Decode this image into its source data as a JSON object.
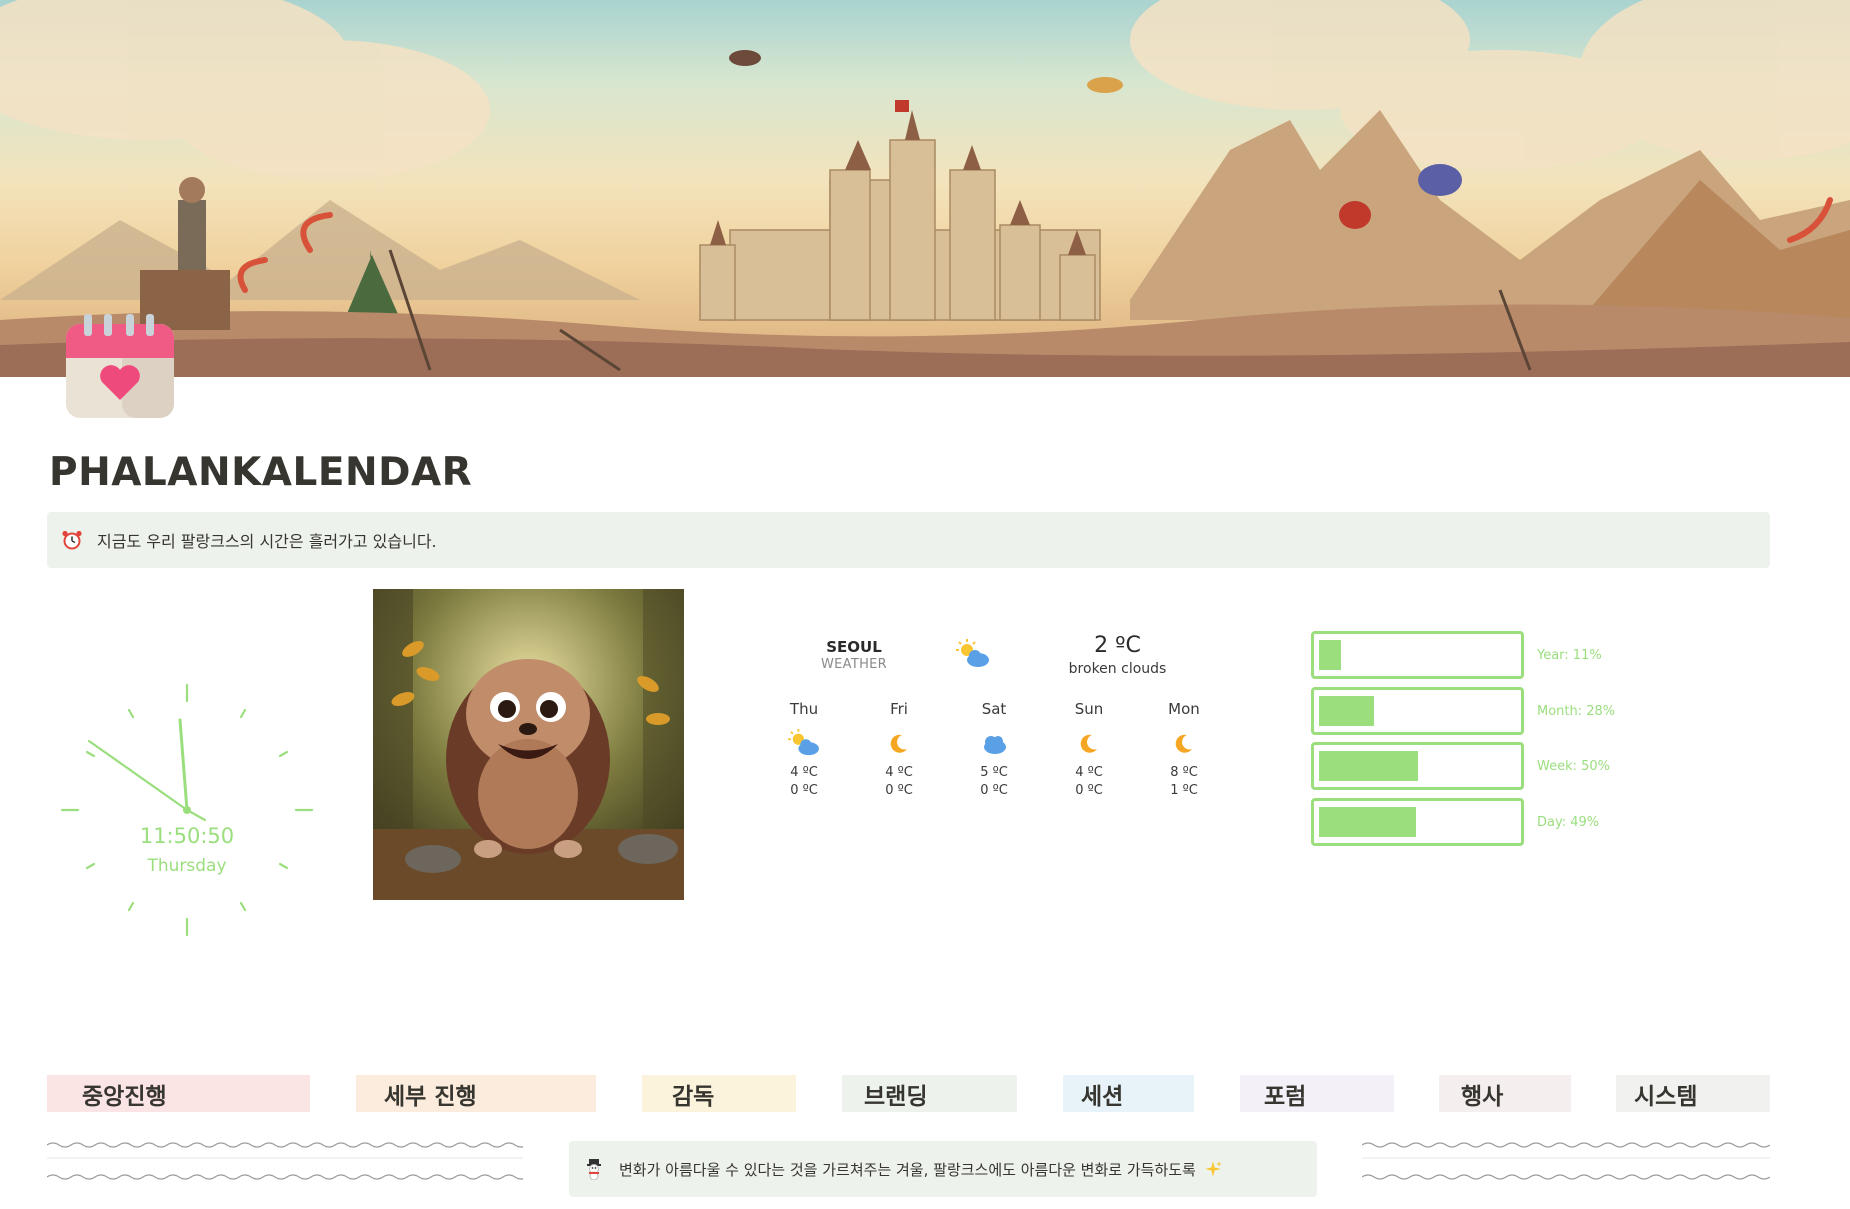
{
  "page": {
    "title": "PHALANKALENDAR",
    "icon": "calendar-heart-icon"
  },
  "callout": {
    "icon": "alarm-clock-icon",
    "text": "지금도 우리 팔랑크스의 시간은 흘러가고 있습니다."
  },
  "clock": {
    "time": "11:50:50",
    "day": "Thursday",
    "accent_color": "#9bde7e"
  },
  "weather": {
    "city": "SEOUL",
    "label": "WEATHER",
    "current_icon": "sun-behind-cloud-icon",
    "temperature": "2 ºC",
    "description": "broken clouds",
    "forecast": [
      {
        "day": "Thu",
        "icon": "sun-behind-cloud-icon",
        "high": "4 ºC",
        "low": "0 ºC"
      },
      {
        "day": "Fri",
        "icon": "crescent-moon-icon",
        "high": "4 ºC",
        "low": "0 ºC"
      },
      {
        "day": "Sat",
        "icon": "cloud-icon",
        "high": "5 ºC",
        "low": "0 ºC"
      },
      {
        "day": "Sun",
        "icon": "crescent-moon-icon",
        "high": "4 ºC",
        "low": "0 ºC"
      },
      {
        "day": "Mon",
        "icon": "crescent-moon-icon",
        "high": "8 ºC",
        "low": "1 ºC"
      }
    ]
  },
  "progress": [
    {
      "label": "Year: 11%",
      "value": 11
    },
    {
      "label": "Month: 28%",
      "value": 28
    },
    {
      "label": "Week: 50%",
      "value": 50
    },
    {
      "label": "Day: 49%",
      "value": 49
    }
  ],
  "categories": [
    {
      "label": "중앙진행",
      "color": "#fbe4e4"
    },
    {
      "label": "세부 진행",
      "color": "#fbecdd"
    },
    {
      "label": "감독",
      "color": "#fbf3db"
    },
    {
      "label": "브랜딩",
      "color": "#edf3ec"
    },
    {
      "label": "세션",
      "color": "#e7f3f8"
    },
    {
      "label": "포럼",
      "color": "#f4f0f7"
    },
    {
      "label": "행사",
      "color": "#f4eeee"
    },
    {
      "label": "시스템",
      "color": "#f1f1ef"
    }
  ],
  "bottom_callout": {
    "icon": "snowman-icon",
    "text": "변화가 아름다울 수 있다는 것을 가르쳐주는 겨울, 팔랑크스에도 아름다운 변화로 가득하도록",
    "trail_icon": "sparkles-icon"
  }
}
